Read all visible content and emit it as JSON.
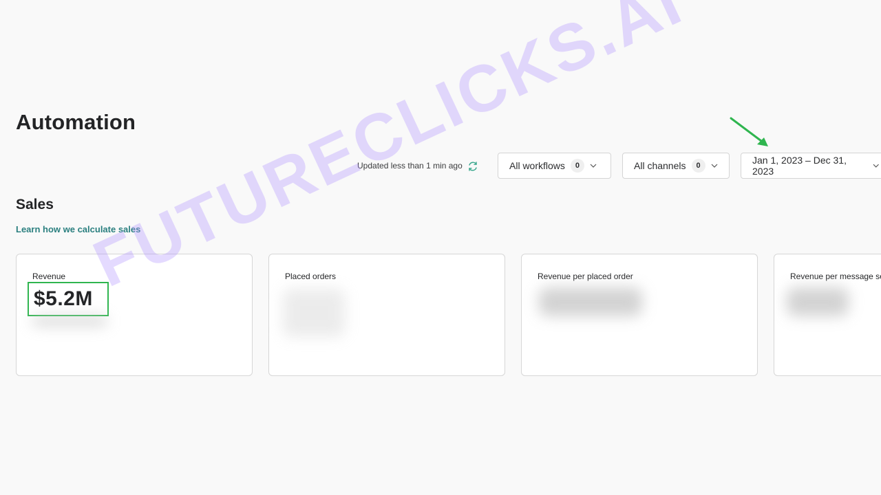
{
  "page": {
    "title": "Automation"
  },
  "toolbar": {
    "updated_text": "Updated less than 1 min ago",
    "refresh_icon": "refresh-icon",
    "filters": {
      "workflows": {
        "label": "All workflows",
        "count": "0"
      },
      "channels": {
        "label": "All channels",
        "count": "0"
      },
      "date_range": {
        "label": "Jan 1, 2023 – Dec 31, 2023"
      }
    }
  },
  "sales": {
    "title": "Sales",
    "learn_link": "Learn how we calculate sales",
    "cards": [
      {
        "label": "Revenue",
        "value": "$5.2M"
      },
      {
        "label": "Placed orders"
      },
      {
        "label": "Revenue per placed order"
      },
      {
        "label": "Revenue per message sent"
      }
    ]
  },
  "watermark": {
    "text": "FUTURECLICKS.AI"
  },
  "colors": {
    "background": "#f9f9f9",
    "link": "#2a7f7f",
    "highlight": "#2fb54f",
    "watermark": "#aa8cff"
  }
}
